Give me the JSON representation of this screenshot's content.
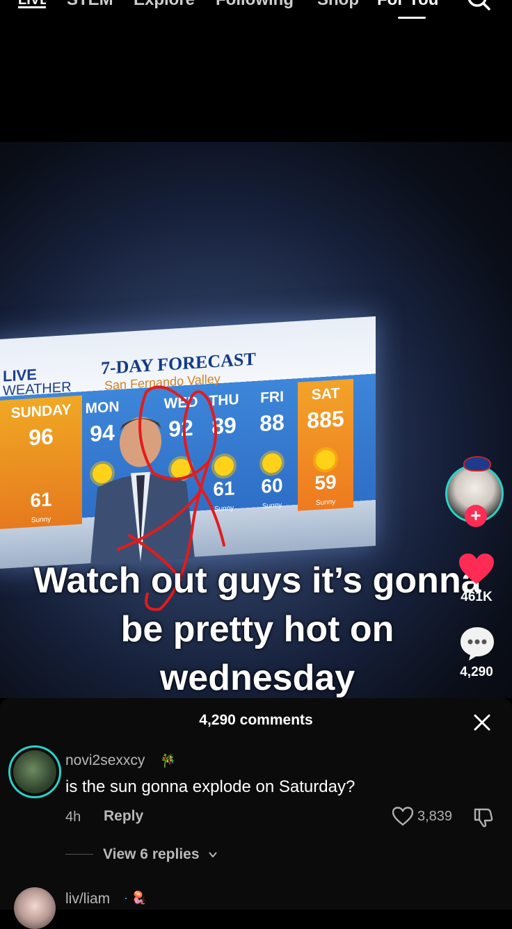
{
  "top_nav": {
    "items": [
      "LIVE",
      "STEM",
      "Explore",
      "Following",
      "Shop",
      "For You"
    ],
    "active": "For You"
  },
  "video": {
    "tv": {
      "logo_line1": "LIVE",
      "logo_line2": "WEATHER",
      "title": "7-DAY FORECAST",
      "subtitle": "San Fernando Valley",
      "days": [
        {
          "name": "SUNDAY",
          "high": "96",
          "low": "61",
          "condition": "Sunny"
        },
        {
          "name": "MON",
          "high": "94",
          "low": "",
          "condition": ""
        },
        {
          "name": "WED",
          "high": "92",
          "low": "",
          "condition": ""
        },
        {
          "name": "THU",
          "high": "89",
          "low": "61",
          "condition": "Sunny"
        },
        {
          "name": "FRI",
          "high": "88",
          "low": "60",
          "condition": "Sunny"
        },
        {
          "name": "SAT",
          "high": "885",
          "low": "59",
          "condition": "Sunny"
        }
      ]
    },
    "caption": "Watch out guys it’s gonna be pretty hot on wednesday"
  },
  "side_actions": {
    "likes": "461K",
    "comments": "4,290"
  },
  "comments_sheet": {
    "title": "4,290 comments",
    "comments": [
      {
        "user": "novi2sexxcy",
        "text": "is the sun gonna explode on Saturday?",
        "time": "4h",
        "reply_label": "Reply",
        "likes": "3,839",
        "view_replies": "View 6 replies"
      },
      {
        "user": "liv/liam"
      }
    ]
  },
  "colors": {
    "accent_red": "#fe2c55",
    "avatar_ring": "#29d3c8"
  }
}
